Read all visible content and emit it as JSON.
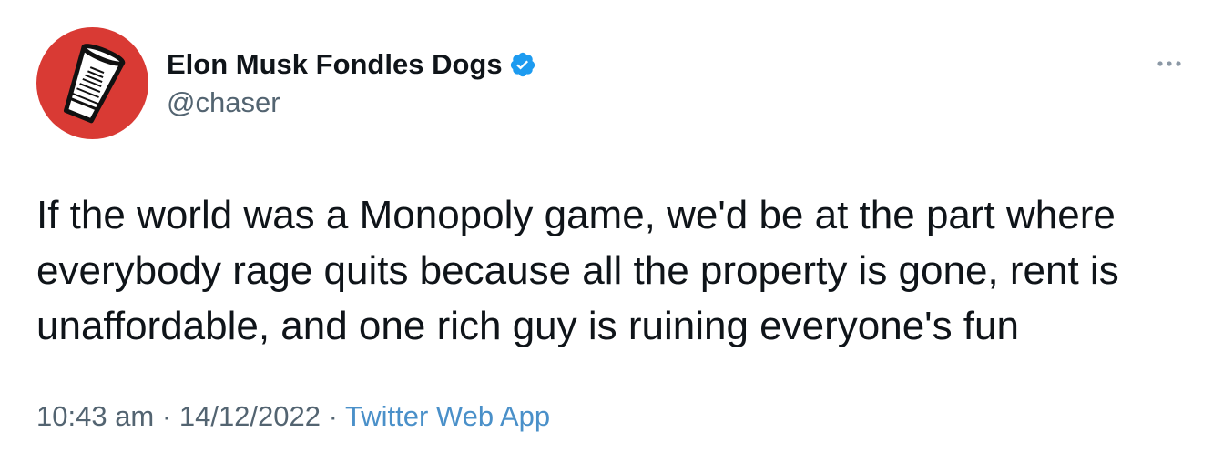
{
  "author": {
    "display_name": "Elon Musk Fondles Dogs",
    "handle": "@chaser",
    "verified": true,
    "avatar_icon": "plastic-cup-icon",
    "avatar_color": "#d93a34"
  },
  "tweet": {
    "text": "If the world was a Monopoly game, we'd be at the part where everybody rage quits because all the property is gone, rent is unaffordable, and one rich guy is ruining everyone's fun"
  },
  "meta": {
    "time": "10:43 am",
    "separator": "·",
    "date": "14/12/2022",
    "source": "Twitter Web App"
  },
  "colors": {
    "text": "#0f1419",
    "secondary": "#536471",
    "link": "#4a90c9",
    "verified": "#1d9bf0"
  },
  "icons": {
    "verified": "verified-badge-icon",
    "more": "more-options-icon"
  }
}
